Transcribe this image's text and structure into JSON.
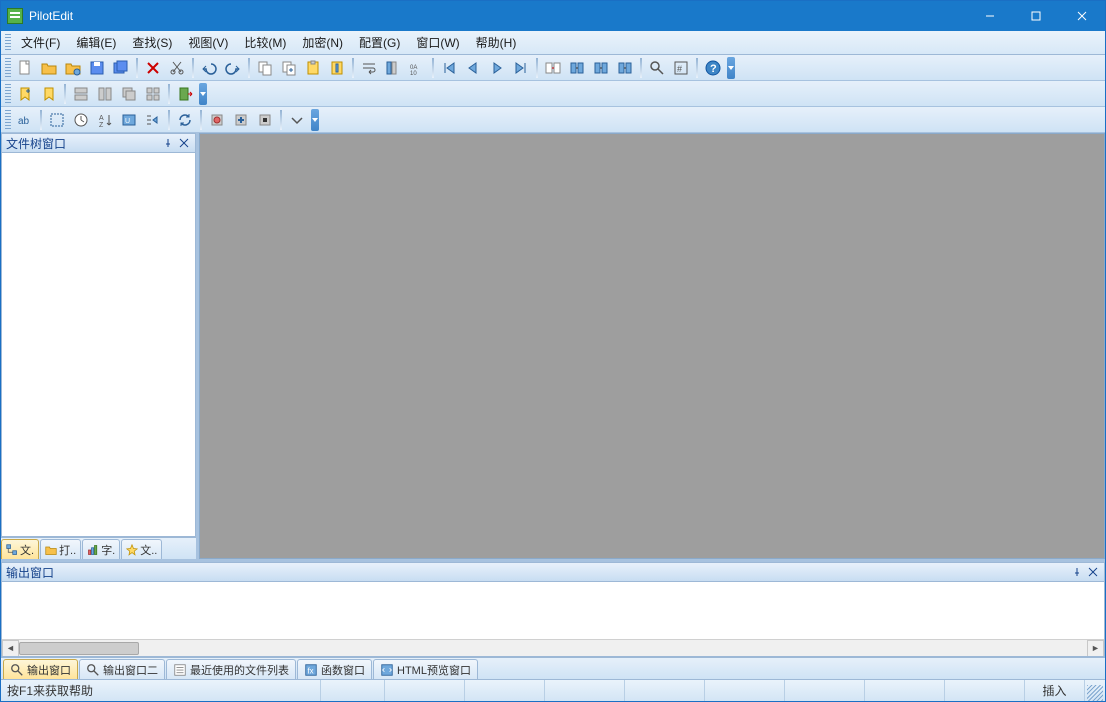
{
  "app": {
    "title": "PilotEdit"
  },
  "menu": [
    {
      "label": "文件(F)"
    },
    {
      "label": "编辑(E)"
    },
    {
      "label": "查找(S)"
    },
    {
      "label": "视图(V)"
    },
    {
      "label": "比较(M)"
    },
    {
      "label": "加密(N)"
    },
    {
      "label": "配置(G)"
    },
    {
      "label": "窗口(W)"
    },
    {
      "label": "帮助(H)"
    }
  ],
  "toolbar1": [
    "new-file",
    "open-file",
    "open-ftp",
    "save",
    "save-all",
    "sep",
    "delete",
    "cut",
    "sep",
    "undo",
    "redo",
    "sep",
    "copy",
    "copy-append",
    "paste",
    "paste-column",
    "sep",
    "word-wrap",
    "column-mode",
    "hex",
    "sep",
    "first",
    "prev",
    "next",
    "last",
    "sep",
    "compare",
    "merge-left",
    "merge-right",
    "merge",
    "sep",
    "find",
    "goto",
    "sep",
    "help"
  ],
  "toolbar2": [
    "bookmark-add",
    "bookmark-list",
    "sep",
    "window-tile-h",
    "window-tile-v",
    "window-cascade",
    "window-arrange",
    "sep",
    "exit"
  ],
  "toolbar3": [
    "string-tools",
    "sep",
    "select-all",
    "date",
    "sort",
    "encoding",
    "indent",
    "sep",
    "refresh",
    "sep",
    "macro-rec",
    "macro-play",
    "macro-stop",
    "sep",
    "collapse"
  ],
  "left_panel": {
    "title": "文件树窗口",
    "tabs": [
      {
        "label": "文.",
        "icon": "tree"
      },
      {
        "label": "打..",
        "icon": "folder"
      },
      {
        "label": "字.",
        "icon": "chart"
      },
      {
        "label": "文..",
        "icon": "star"
      }
    ]
  },
  "output_panel": {
    "title": "输出窗口",
    "tabs": [
      {
        "label": "输出窗口",
        "icon": "find",
        "active": true
      },
      {
        "label": "输出窗口二",
        "icon": "find",
        "active": false
      },
      {
        "label": "最近使用的文件列表",
        "icon": "list",
        "active": false
      },
      {
        "label": "函数窗口",
        "icon": "func",
        "active": false
      },
      {
        "label": "HTML预览窗口",
        "icon": "html",
        "active": false
      }
    ]
  },
  "statusbar": {
    "help": "按F1来获取帮助",
    "insert_mode": "插入"
  }
}
